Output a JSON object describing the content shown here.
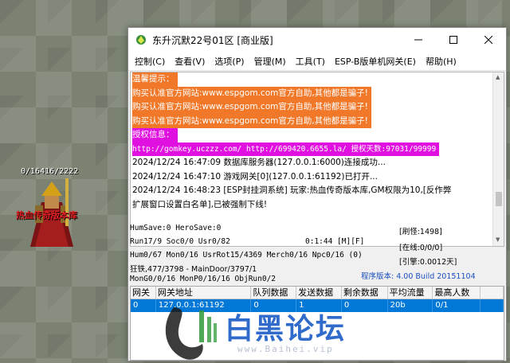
{
  "background": {
    "npc_hp": "0/16416/2222",
    "npc_name": "热血传奇版本库"
  },
  "window": {
    "title": "东升沉默22号01区 [商业版]",
    "controls": {
      "minimize": "—",
      "maximize": "☐",
      "close": "✕"
    }
  },
  "menu": [
    "控制(C)",
    "查看(V)",
    "选项(P)",
    "管理(M)",
    "工具(T)",
    "ESP-B版单机网关(E)",
    "帮助(H)"
  ],
  "log": [
    {
      "text": "温馨提示：",
      "style": "orange"
    },
    {
      "text": "购买认准官方网站:www.espgom.com官方自助,其他都是骗子!",
      "style": "orange"
    },
    {
      "text": "购买认准官方网站:www.espgom.com官方自助,其他都是骗子!",
      "style": "orange"
    },
    {
      "text": "购买认准官方网站:www.espgom.com官方自助,其他都是骗子!",
      "style": "orange"
    },
    {
      "text": "授权信息：",
      "style": "magenta"
    },
    {
      "text": "http://gomkey.uczzz.com/ http://699420.6655.la/ 授权天数:97031/99999",
      "style": "magenta"
    },
    {
      "text": "2024/12/24 16:47:09 数据库服务器(127.0.0.1:6000)连接成功...",
      "style": "plain"
    },
    {
      "text": "2024/12/24 16:47:10 游戏网关[0](127.0.0.1:61192)已打开...",
      "style": "plain"
    },
    {
      "text": "2024/12/24 16:48:23 [ESP封挂洞系统] 玩家:热血传奇版本库,GM权限为10,[反作弊",
      "style": "plain"
    },
    {
      "text": "扩展窗口设置白名单],已被强制下线!",
      "style": "plain"
    }
  ],
  "stats": {
    "humsave": "HumSave:0 HeroSave:0",
    "run": "Run17/9 Soc0/0 Usr0/82",
    "time": "0:1:44 [M][F]",
    "hum": "Hum0/67 Mon0/16 UsrRot15/4369 Merch0/16 Npc0/16 (0)",
    "kuang": "狂铁,477/3798 - MainDoor/3797/1",
    "mongo": "MonG0/0/16 MonP0/16/16 ObjRun0/2",
    "refresh": "[刷怪:1498]",
    "online": "[在线:0/0/0]",
    "engine": "[引擎:0.0012天]",
    "version": "程序版本: 4.00 Build 20151104"
  },
  "gateway_table": {
    "headers": [
      "网关",
      "网关地址",
      "队列数据",
      "发送数据",
      "剩余数据",
      "平均流量",
      "最高人数",
      ""
    ],
    "rows": [
      [
        "0",
        "127.0.0.1:61192",
        "0",
        "1",
        "0",
        "20b",
        "0/1",
        ""
      ]
    ]
  },
  "watermark": {
    "text": "白黑论坛",
    "url": "www.Baihei.vip"
  },
  "colors": {
    "orange_highlight": "#f07828",
    "magenta_highlight": "#e010e0",
    "selection_blue": "#0078d7",
    "version_blue": "#1a4fbf"
  }
}
